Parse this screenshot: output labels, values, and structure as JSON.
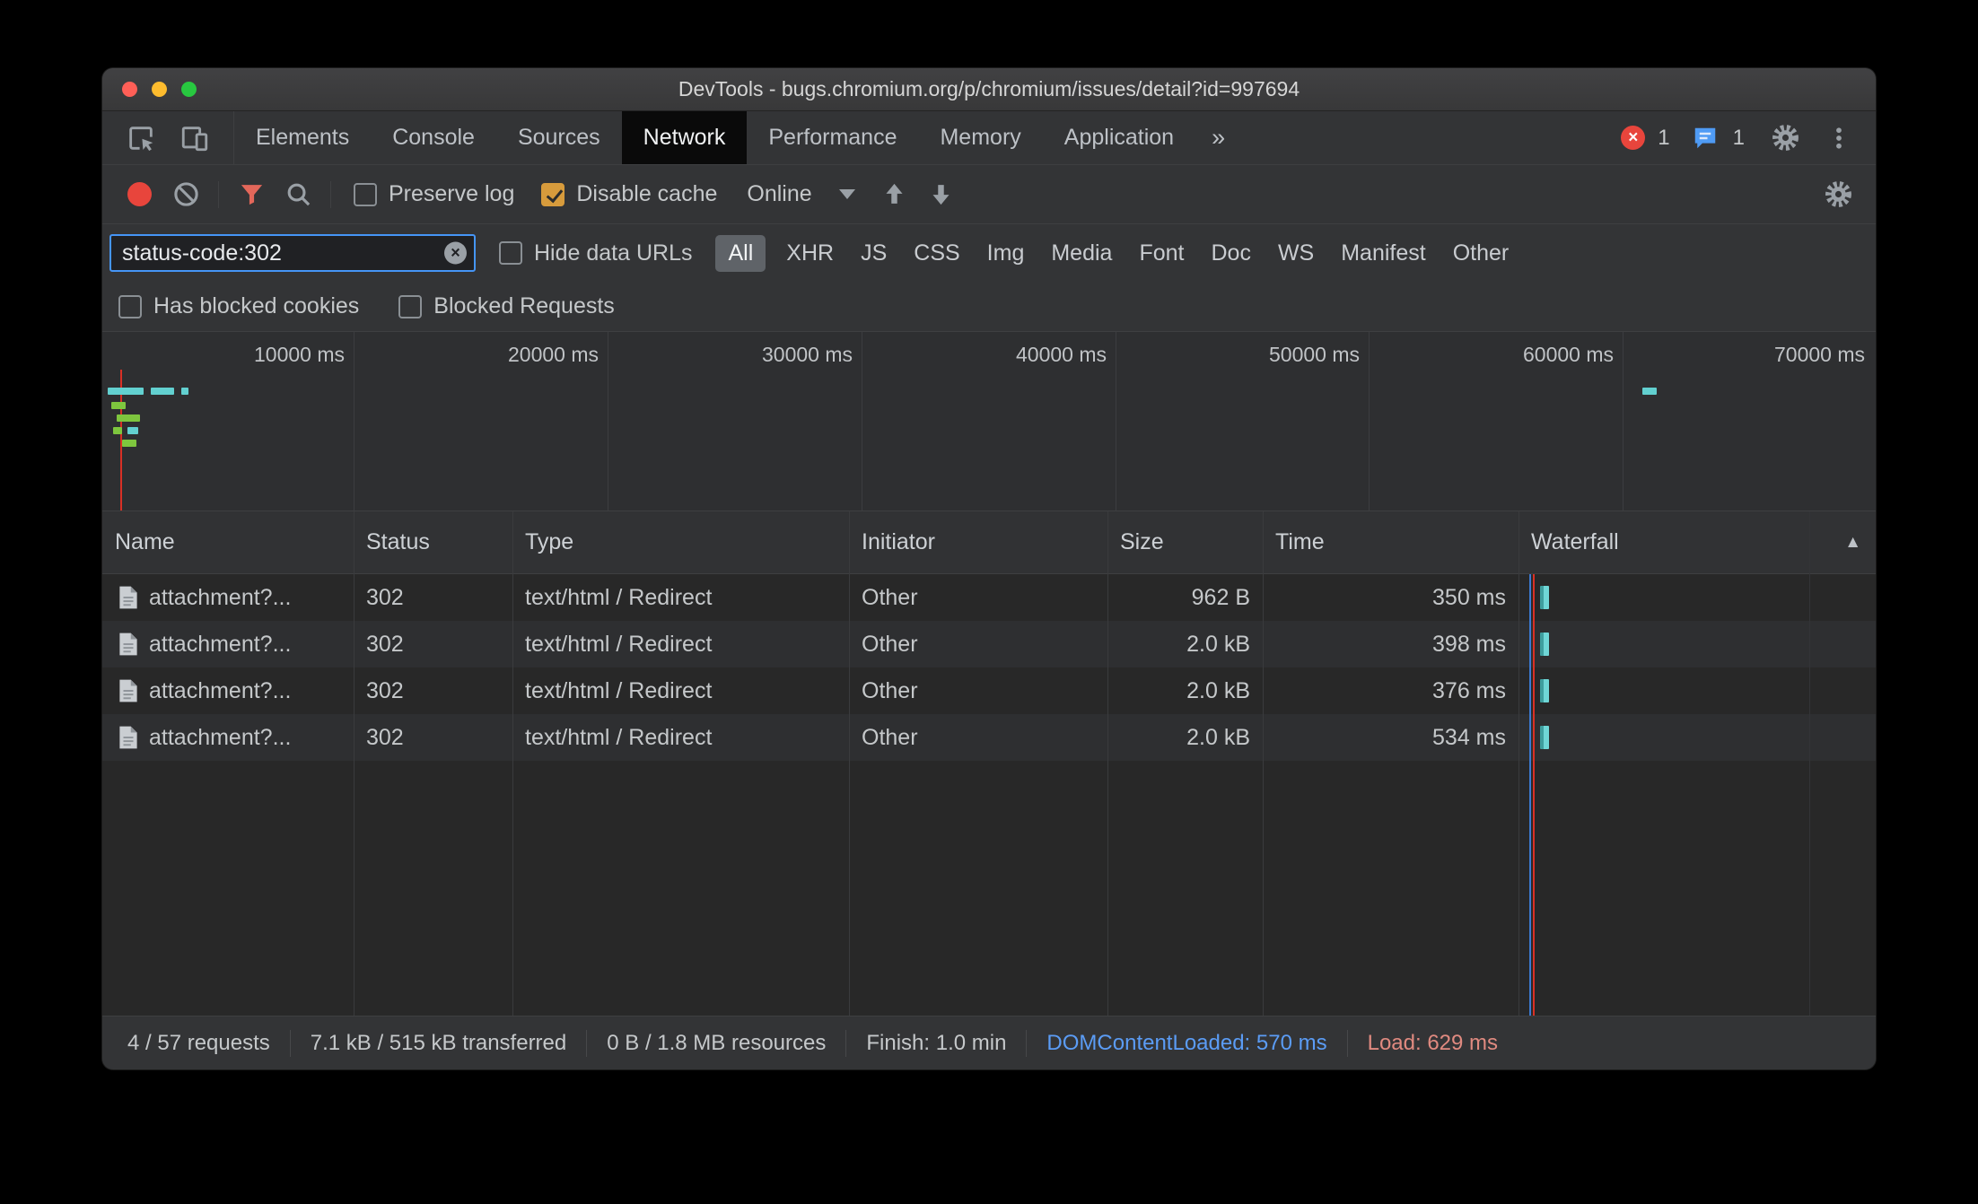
{
  "window": {
    "title": "DevTools - bugs.chromium.org/p/chromium/issues/detail?id=997694"
  },
  "tabbar": {
    "tabs": [
      "Elements",
      "Console",
      "Sources",
      "Network",
      "Performance",
      "Memory",
      "Application"
    ],
    "active_tab": "Network",
    "more_symbol": "»",
    "error_icon_glyph": "×",
    "error_count": "1",
    "issue_count": "1"
  },
  "toolbar": {
    "preserve_log": "Preserve log",
    "preserve_log_checked": false,
    "disable_cache": "Disable cache",
    "disable_cache_checked": true,
    "throttling": "Online"
  },
  "filter": {
    "value": "status-code:302",
    "hide_data_urls": "Hide data URLs",
    "hide_data_urls_checked": false,
    "types": [
      "All",
      "XHR",
      "JS",
      "CSS",
      "Img",
      "Media",
      "Font",
      "Doc",
      "WS",
      "Manifest",
      "Other"
    ],
    "active_type": "All",
    "has_blocked_cookies": "Has blocked cookies",
    "has_blocked_cookies_checked": false,
    "blocked_requests": "Blocked Requests",
    "blocked_requests_checked": false
  },
  "overview": {
    "ticks": [
      "10000 ms",
      "20000 ms",
      "30000 ms",
      "40000 ms",
      "50000 ms",
      "60000 ms",
      "70000 ms"
    ]
  },
  "grid": {
    "columns": [
      "Name",
      "Status",
      "Type",
      "Initiator",
      "Size",
      "Time",
      "Waterfall"
    ],
    "sort_indicator": "▲",
    "rows": [
      {
        "name": "attachment?...",
        "status": "302",
        "type": "text/html / Redirect",
        "initiator": "Other",
        "size": "962 B",
        "time": "350 ms"
      },
      {
        "name": "attachment?...",
        "status": "302",
        "type": "text/html / Redirect",
        "initiator": "Other",
        "size": "2.0 kB",
        "time": "398 ms"
      },
      {
        "name": "attachment?...",
        "status": "302",
        "type": "text/html / Redirect",
        "initiator": "Other",
        "size": "2.0 kB",
        "time": "376 ms"
      },
      {
        "name": "attachment?...",
        "status": "302",
        "type": "text/html / Redirect",
        "initiator": "Other",
        "size": "2.0 kB",
        "time": "534 ms"
      }
    ]
  },
  "status": {
    "requests": "4 / 57 requests",
    "transferred": "7.1 kB / 515 kB transferred",
    "resources": "0 B / 1.8 MB resources",
    "finish": "Finish: 1.0 min",
    "dom_content_loaded": "DOMContentLoaded: 570 ms",
    "load": "Load: 629 ms"
  },
  "colors": {
    "accent_blue": "#4595f6",
    "record_red": "#e8453c",
    "filter_active_red": "#e3675a",
    "checkbox_checked_amber": "#d79b3c",
    "waterfall_teal": "#6fd6d6",
    "overview_green": "#7ec63e",
    "load_line_red": "#d93025",
    "dcl_text_blue": "#5b9cf5",
    "load_text_red": "#e08a80"
  }
}
